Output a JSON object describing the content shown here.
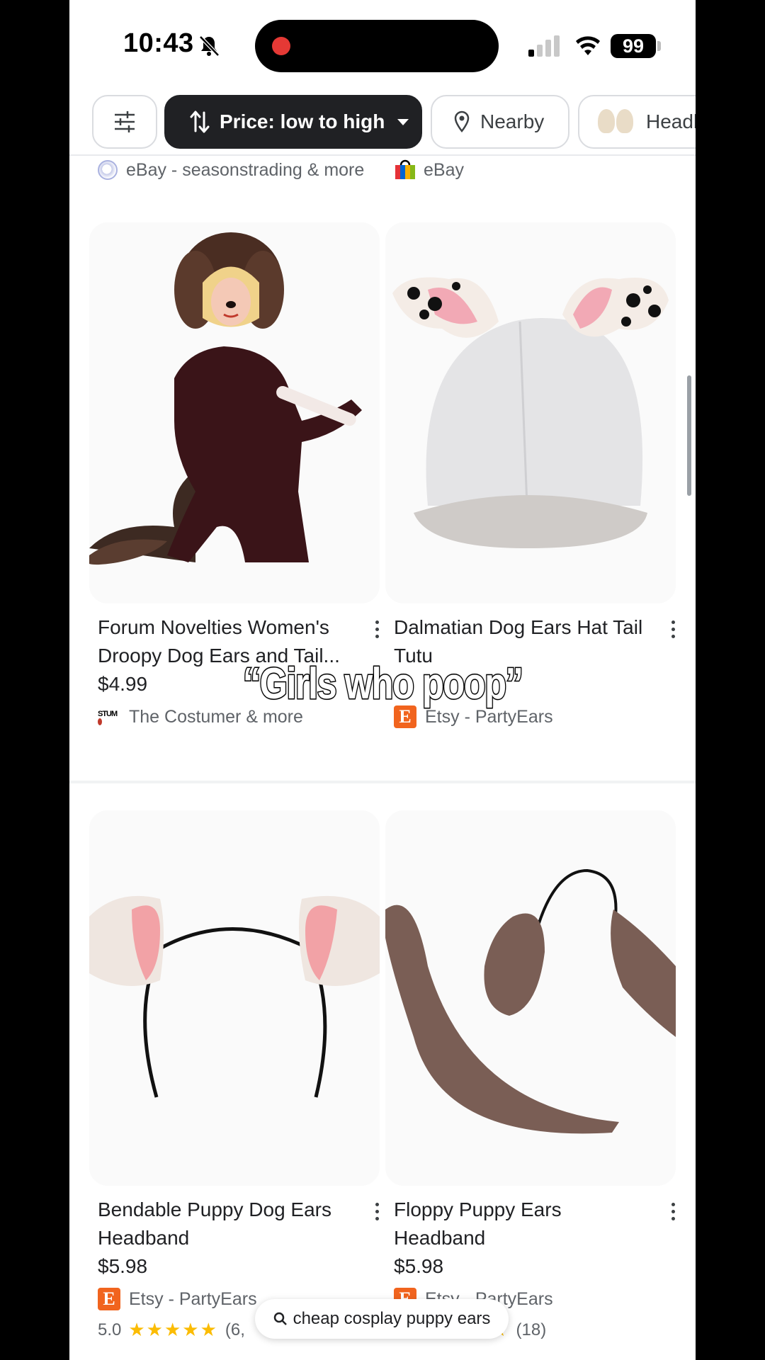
{
  "status_bar": {
    "time": "10:43",
    "battery": "99"
  },
  "chips": {
    "price_label": "Price: low to high",
    "nearby_label": "Nearby",
    "headbands_label": "Headb"
  },
  "sources_top": {
    "left": "eBay - seasonstrading & more",
    "right": "eBay"
  },
  "products": [
    {
      "title": "Forum Novelties Women's Droopy Dog Ears and Tail...",
      "price": "$4.99",
      "seller": "The Costumer & more"
    },
    {
      "title": "Dalmatian Dog Ears Hat Tail Tutu",
      "price": "",
      "seller": "Etsy - PartyEars"
    },
    {
      "title": "Bendable Puppy Dog Ears Headband",
      "price": "$5.98",
      "seller": "Etsy - PartyEars",
      "rating": "5.0",
      "reviews": "(6,"
    },
    {
      "title": "Floppy Puppy Ears Headband",
      "price": "$5.98",
      "seller": "Etsy - PartyEars",
      "reviews": "(18)"
    }
  ],
  "overlay": {
    "caption": "“Girls who poop”",
    "search_query": "cheap cosplay puppy ears"
  },
  "colors": {
    "accent": "#202124",
    "etsy": "#f1641e",
    "stars": "#fbbc04",
    "record": "#e53935"
  },
  "icons": [
    "bell-off-icon",
    "signal-icon",
    "wifi-icon",
    "filter-icon",
    "sort-icon",
    "location-pin-icon",
    "globe-icon",
    "ebay-bag-icon",
    "etsy-icon",
    "more-vert-icon",
    "search-icon"
  ]
}
